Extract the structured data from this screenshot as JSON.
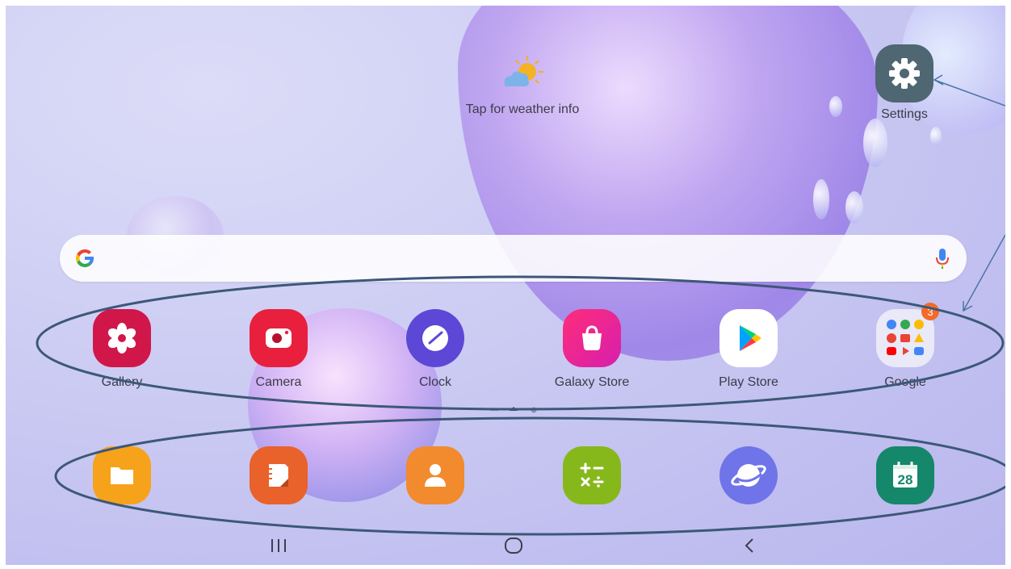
{
  "weather": {
    "label": "Tap for weather info",
    "icon": "partly-sunny-icon"
  },
  "settings": {
    "label": "Settings",
    "icon": "gear-icon"
  },
  "search": {
    "icon": "google-g-icon",
    "mic_icon": "microphone-icon"
  },
  "apps_row1": [
    {
      "label": "Gallery",
      "icon": "flower-icon",
      "color": "#d1174a"
    },
    {
      "label": "Camera",
      "icon": "camera-icon",
      "color": "#e8203e"
    },
    {
      "label": "Clock",
      "icon": "clock-icon",
      "color": "#5c47d6"
    },
    {
      "label": "Galaxy Store",
      "icon": "shopping-bag-icon",
      "color": "#e0208a"
    },
    {
      "label": "Play Store",
      "icon": "play-triangle-icon",
      "color": "#ffffff"
    },
    {
      "label": "Google",
      "icon": "google-folder-icon",
      "badge": "3"
    }
  ],
  "apps_row2": [
    {
      "icon": "folder-icon",
      "color": "#f7a21b"
    },
    {
      "icon": "notes-icon",
      "color": "#e9612b"
    },
    {
      "icon": "contacts-icon",
      "color": "#f28a2e"
    },
    {
      "icon": "calculator-icon",
      "color": "#86b81c"
    },
    {
      "icon": "internet-planet-icon",
      "color": "#6f74e8"
    },
    {
      "icon": "calendar-icon",
      "color": "#15876a",
      "day": "28"
    }
  ],
  "page_indicator": {
    "pages": 3,
    "current": 1
  },
  "nav": {
    "recents": "recents-icon",
    "home": "home-icon",
    "back": "back-icon"
  }
}
